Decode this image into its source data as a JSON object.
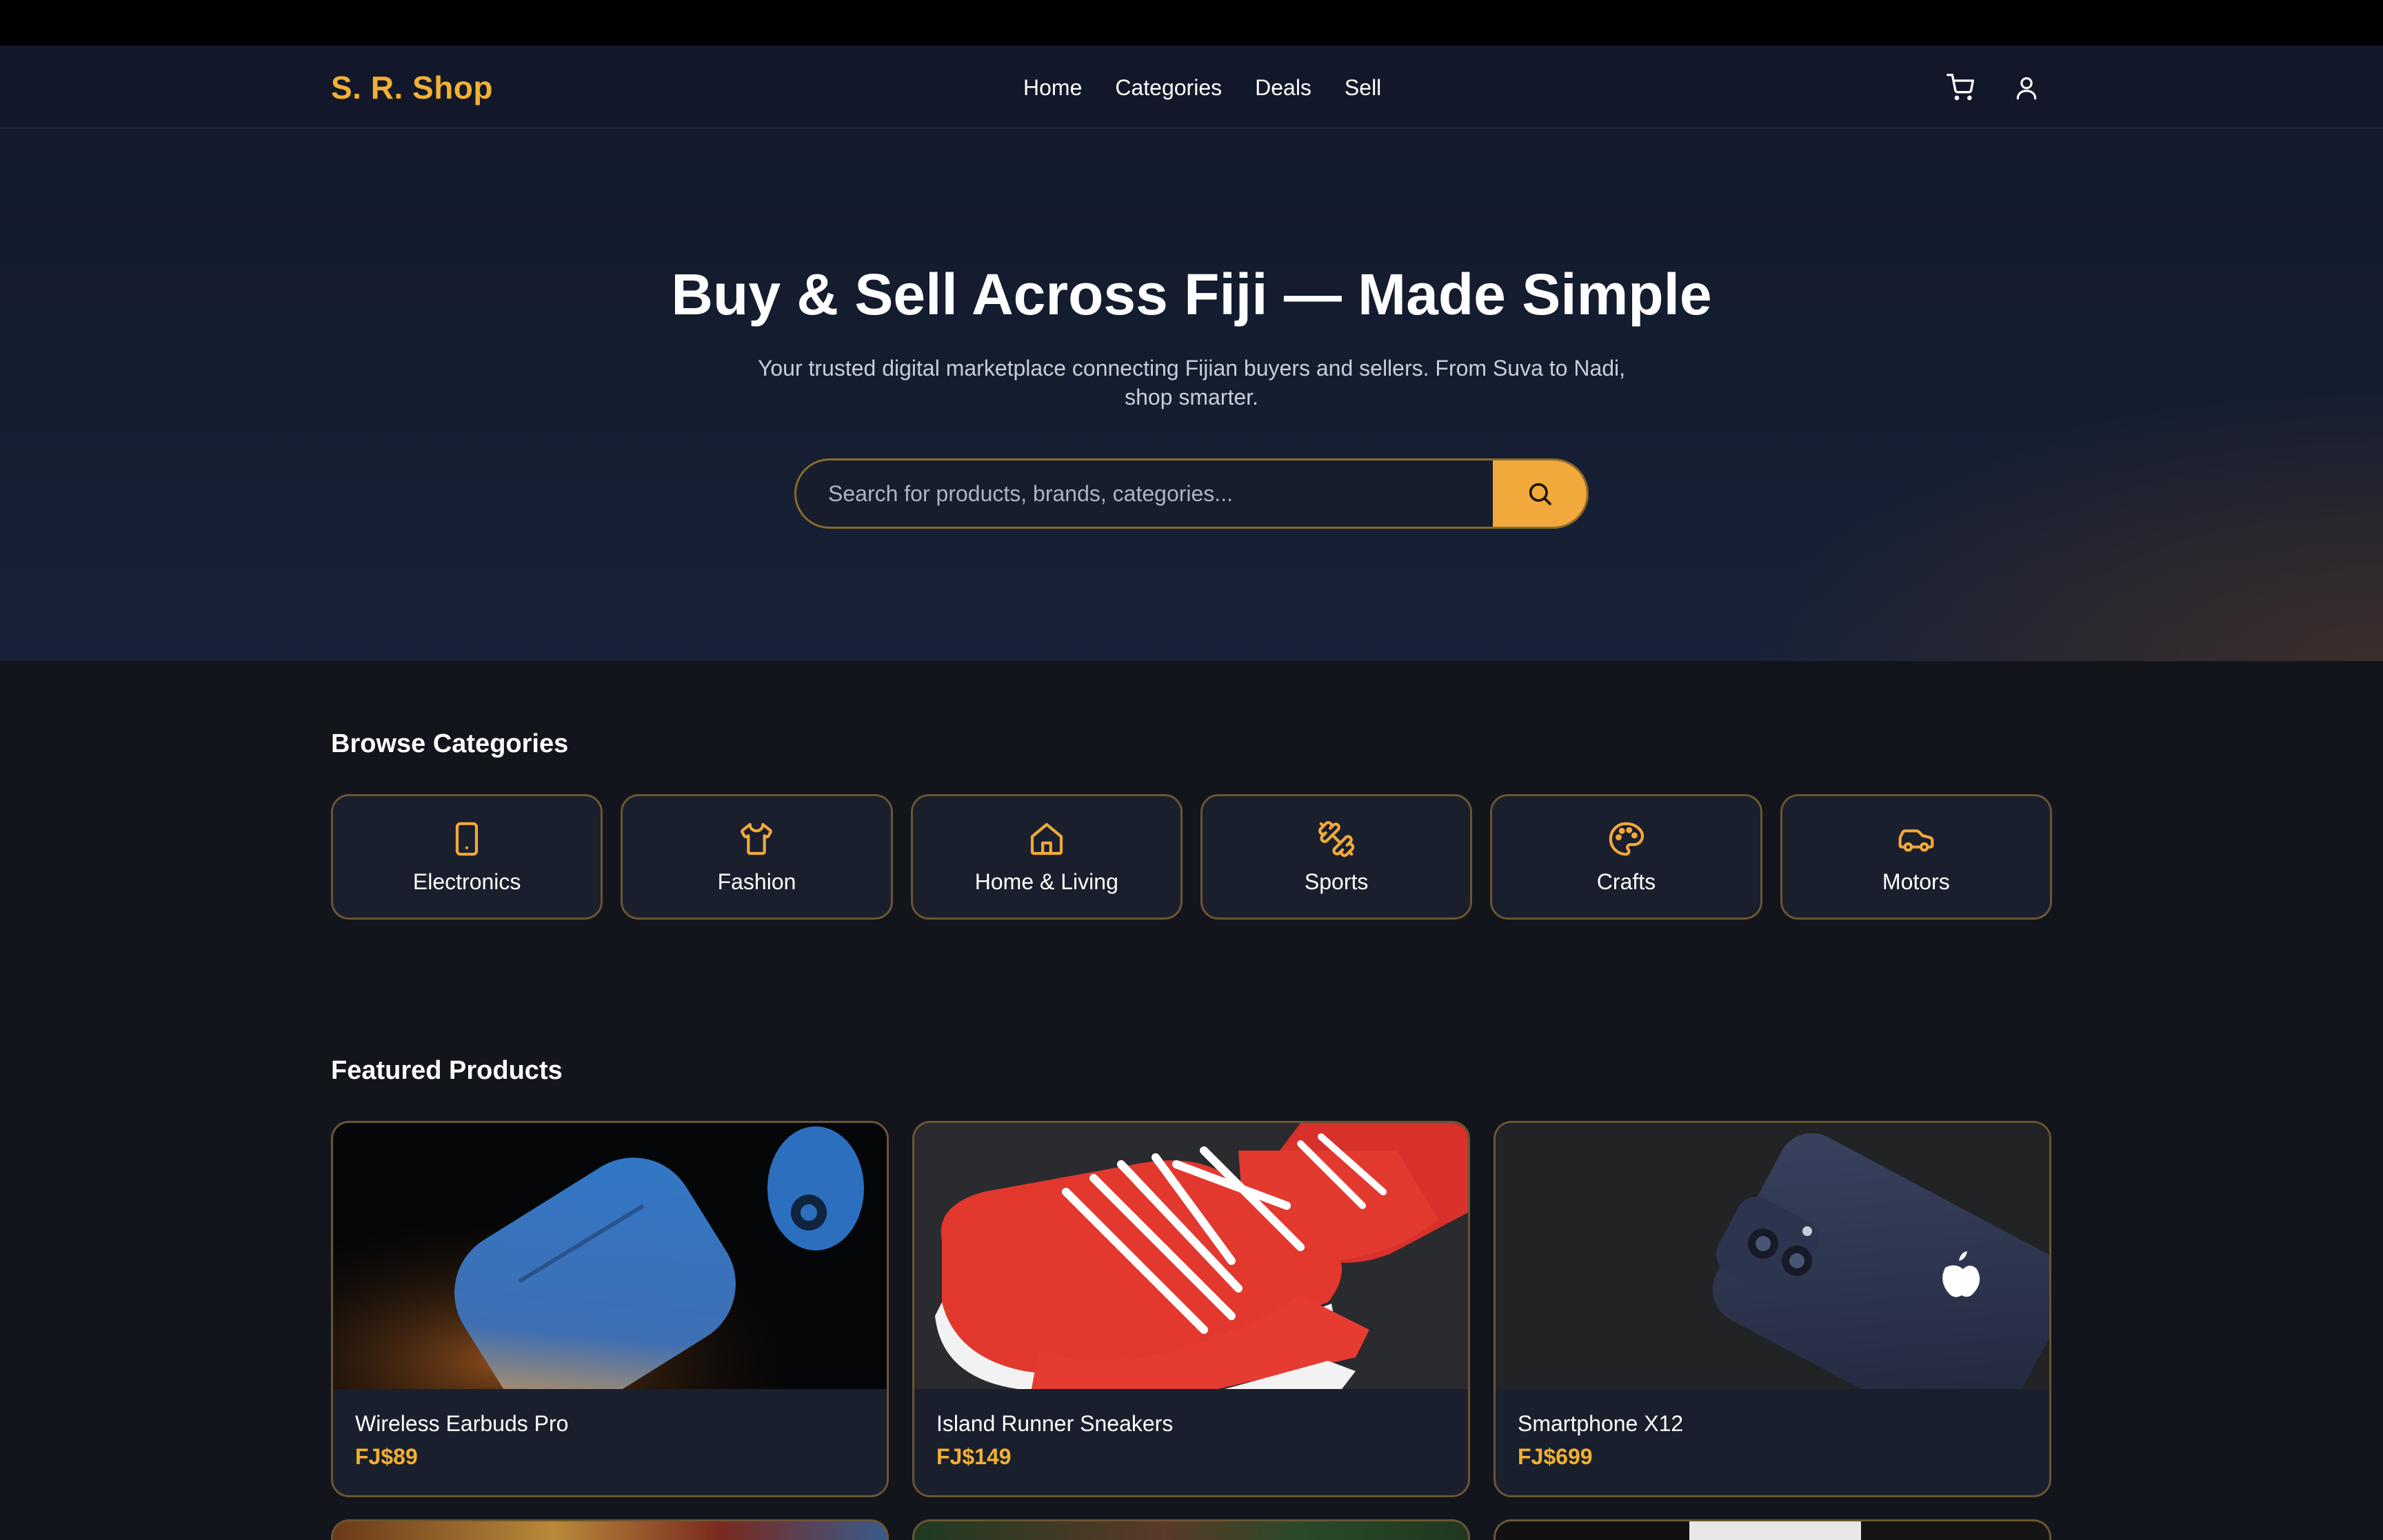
{
  "brand": {
    "name": "S. R. Shop",
    "accent": "#f2b034"
  },
  "nav": {
    "items": [
      "Home",
      "Categories",
      "Deals",
      "Sell"
    ]
  },
  "header_icons": [
    "cart-icon",
    "user-icon"
  ],
  "hero": {
    "title": "Buy & Sell Across Fiji — Made Simple",
    "subtitle": "Your trusted digital marketplace connecting Fijian buyers and sellers. From Suva to Nadi, shop smarter.",
    "search_placeholder": "Search for products, brands, categories..."
  },
  "categories": {
    "title": "Browse Categories",
    "items": [
      {
        "label": "Electronics",
        "icon": "smartphone-icon"
      },
      {
        "label": "Fashion",
        "icon": "shirt-icon"
      },
      {
        "label": "Home & Living",
        "icon": "house-icon"
      },
      {
        "label": "Sports",
        "icon": "dumbbell-icon"
      },
      {
        "label": "Crafts",
        "icon": "palette-icon"
      },
      {
        "label": "Motors",
        "icon": "car-icon"
      }
    ]
  },
  "featured": {
    "title": "Featured Products",
    "products": [
      {
        "name": "Wireless Earbuds Pro",
        "price": "FJ$89"
      },
      {
        "name": "Island Runner Sneakers",
        "price": "FJ$149"
      },
      {
        "name": "Smartphone X12",
        "price": "FJ$699"
      }
    ]
  }
}
